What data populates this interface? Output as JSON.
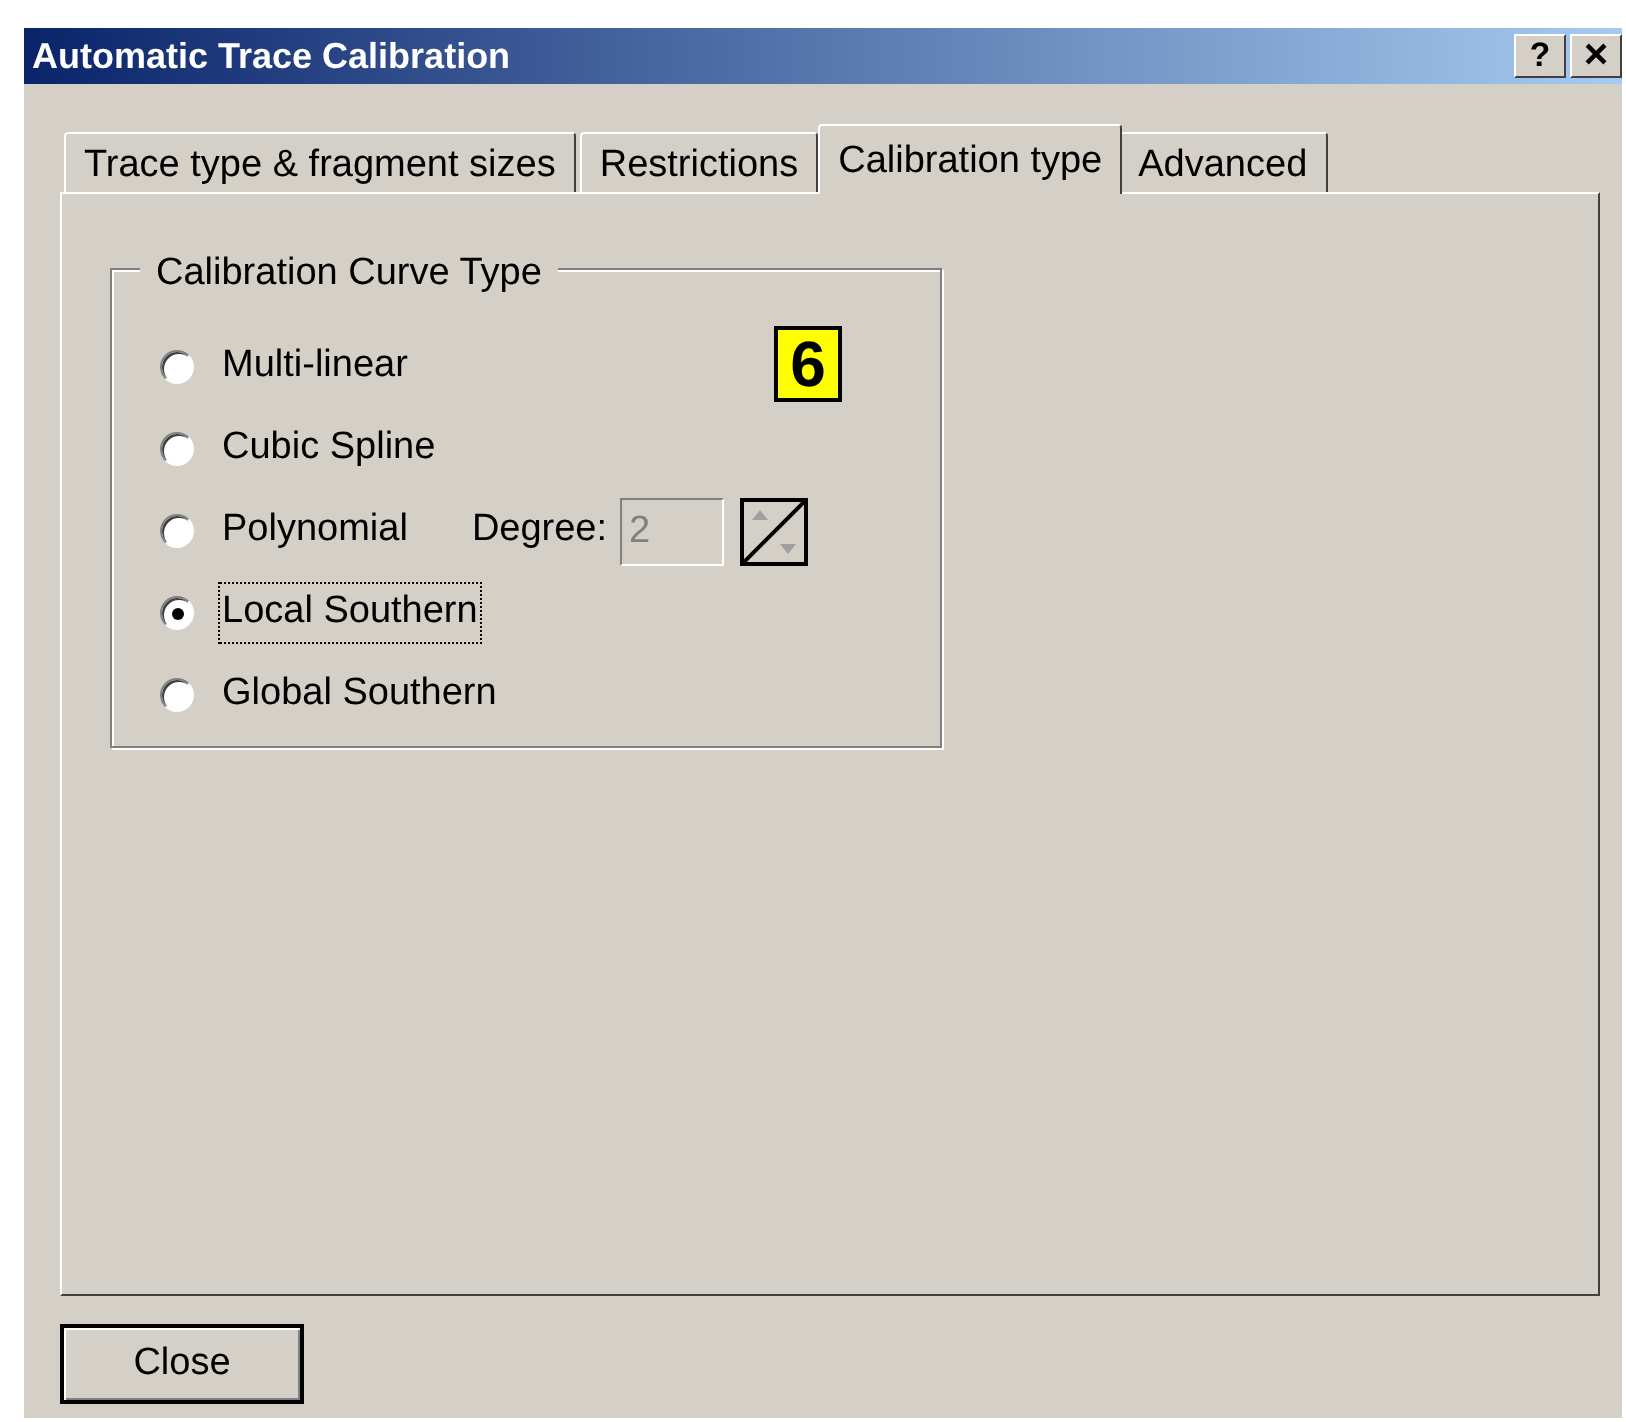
{
  "window": {
    "title": "Automatic Trace Calibration",
    "buttons": [
      {
        "kind": "help",
        "label": "?"
      },
      {
        "kind": "close",
        "label": "×"
      }
    ]
  },
  "tabs": [
    {
      "label": "Trace type & fragment sizes",
      "selected": false
    },
    {
      "label": "Restrictions",
      "selected": false
    },
    {
      "label": "Calibration type",
      "selected": true
    },
    {
      "label": "Advanced",
      "selected": false
    }
  ],
  "group": {
    "title": "Calibration Curve Type",
    "options": [
      {
        "label": "Multi-linear",
        "selected": false,
        "focused": false
      },
      {
        "label": "Cubic Spline",
        "selected": false,
        "focused": false
      },
      {
        "label": "Polynomial",
        "selected": false,
        "focused": false,
        "degree": {
          "label": "Degree:",
          "value": "2",
          "disabled": true
        }
      },
      {
        "label": "Local Southern",
        "selected": true,
        "focused": true
      },
      {
        "label": "Global Southern",
        "selected": false,
        "focused": false
      }
    ]
  },
  "callout": "6",
  "buttons": [
    {
      "label": "Close"
    }
  ]
}
